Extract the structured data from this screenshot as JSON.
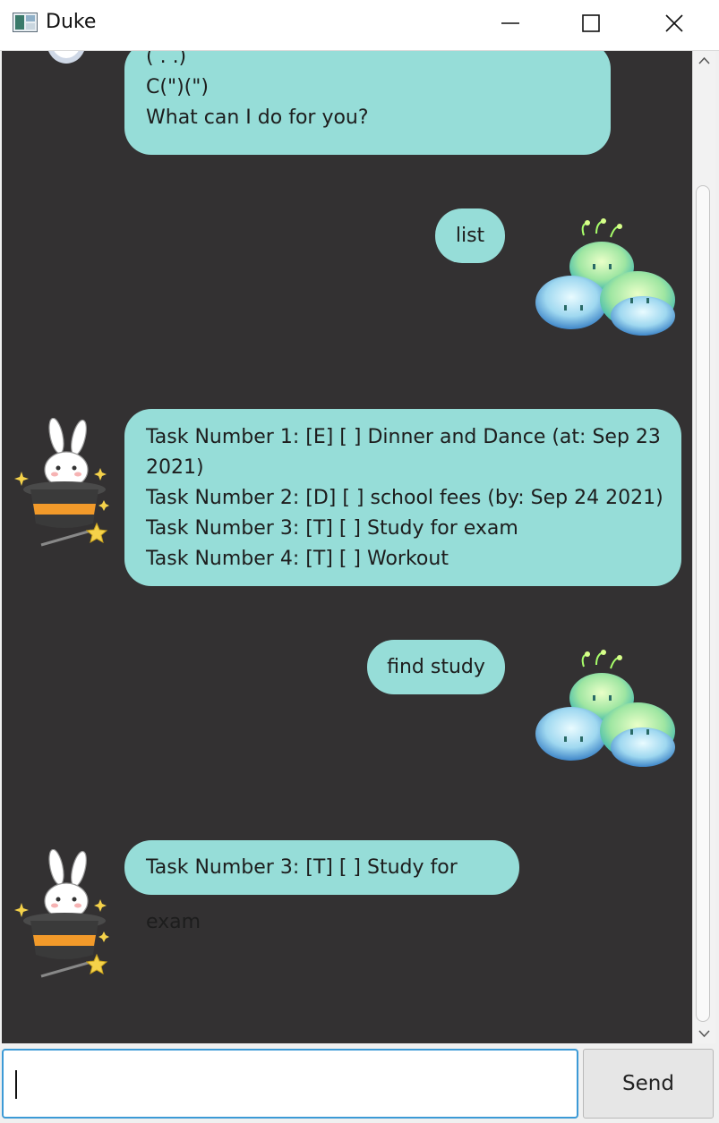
{
  "window": {
    "title": "Duke"
  },
  "messages": [
    {
      "from": "duke",
      "lines": [
        "( . .)",
        "C(\")(\")",
        "What can I do for you?"
      ]
    },
    {
      "from": "user",
      "lines": [
        "list"
      ]
    },
    {
      "from": "duke",
      "lines": [
        "Task Number 1: [E] [ ] Dinner and Dance (at: Sep 23",
        "2021)",
        "Task Number 2: [D] [ ] school fees (by: Sep 24 2021)",
        "Task Number 3: [T] [ ] Study for exam",
        "Task Number 4: [T] [ ] Workout"
      ]
    },
    {
      "from": "user",
      "lines": [
        "find study"
      ]
    },
    {
      "from": "duke",
      "lines": [
        "Task Number 3: [T] [ ] Study for exam"
      ]
    }
  ],
  "input": {
    "value": "",
    "placeholder": ""
  },
  "send_label": "Send",
  "icons": {
    "duke_avatar": "bunny-in-hat-icon",
    "user_avatar": "slime-pile-icon"
  },
  "colors": {
    "bubble": "#96ddd8",
    "chat_background": "#333132",
    "input_focus": "#3c9ad6"
  }
}
